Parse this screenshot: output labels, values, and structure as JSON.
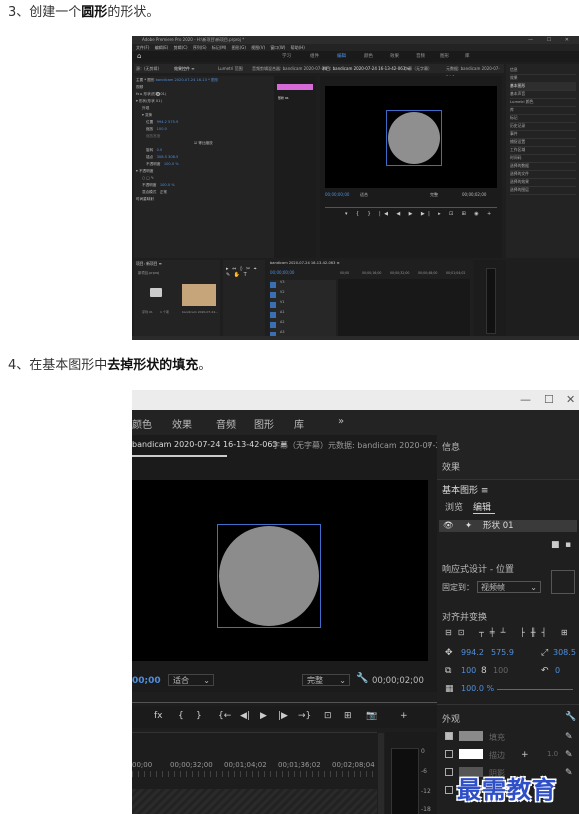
{
  "step3": {
    "num": "3、",
    "pre": "创建一个",
    "bold": "圆形",
    "post": "的形状。"
  },
  "step4": {
    "num": "4、",
    "pre": "在基本图形中",
    "bold": "去掉形状的填充",
    "post": "。"
  },
  "shot1": {
    "window_title": "Adobe Premiere Pro 2020 - H:\\新项目\\新项目.prproj *",
    "window_controls": "— ☐ ✕",
    "menu": [
      "文件(F)",
      "编辑(E)",
      "剪辑(C)",
      "序列(S)",
      "标记(M)",
      "图形(G)",
      "视图(V)",
      "窗口(W)",
      "帮助(H)"
    ],
    "workspaces": [
      "学习",
      "组件",
      "编辑",
      "颜色",
      "效果",
      "音频",
      "图形",
      "库"
    ],
    "panel_tabs": {
      "source": "源：(无剪辑)",
      "effect_controls": "效果控件 ≡",
      "lumetri": "Lumetri 范围",
      "audio_mixer": "音频剪辑混合器: bandicam 2020-07-24",
      "program": "节目: bandicam 2020-07-24 16-13-42-063 ≡",
      "captions": "字幕（无字幕）",
      "metadata": "元数据: bandicam 2020-07-24 1"
    },
    "ec_rows": [
      {
        "label": "主要 * 图形",
        "value": "bandicam 2020-07-24 16-13 * 图形"
      },
      {
        "label": "视频",
        "value": ""
      },
      {
        "label": "fx ▸ 形状(形状 01)",
        "value": ""
      },
      {
        "label": "▾ 形状(形状 01)",
        "value": ""
      },
      {
        "label": "外观",
        "value": ""
      },
      {
        "label": "▾ 变换",
        "value": ""
      },
      {
        "label": "位置",
        "value": "994.2   575.9"
      },
      {
        "label": "缩放",
        "value": "100.0"
      },
      {
        "label": "缩放宽度",
        "value": ""
      },
      {
        "label": "",
        "value": "☑ 等比缩放"
      },
      {
        "label": "旋转",
        "value": "0.0"
      },
      {
        "label": "锚点",
        "value": "308.5   308.5"
      },
      {
        "label": "不透明度",
        "value": "100.0 %"
      },
      {
        "label": "▾ 不透明度",
        "value": ""
      },
      {
        "label": "○ □ ✎",
        "value": ""
      },
      {
        "label": "不透明度",
        "value": "100.0 %"
      },
      {
        "label": "混合模式",
        "value": "正常"
      },
      {
        "label": "时间重映射",
        "value": ""
      }
    ],
    "ec_clip": "形状 01",
    "program_tc_left": "00;00;00;00",
    "program_fit": "适合",
    "program_full": "完整",
    "program_tc_right": "00;00;02;00",
    "right_panel": [
      "信息",
      "效果",
      "基本图形",
      "基本声音",
      "Lumetri 颜色",
      "库",
      "标记",
      "历史记录",
      "事件",
      "捕捉设置",
      "工作区域",
      "时间码",
      "选择的数据",
      "选择的文件",
      "选择的效果",
      "选择的图层"
    ],
    "right_panel_selected": "基本图形",
    "project": {
      "title": "项目: 新项目 ≡",
      "file": "新项目.prproj",
      "items": [
        "序列 01",
        "1 个项",
        "bandicam 2020-07-24..."
      ]
    },
    "timeline": {
      "title": "bandicam 2020-07-24 16-13-42-063 ≡",
      "timecode": "00;00;00;00",
      "ruler": [
        "00;00",
        "00;00;16;00",
        "00;00;32;00",
        "00;00;48;00",
        "00;01;04;02"
      ],
      "tracks": [
        "V3",
        "V2",
        "V1",
        "A1",
        "A2",
        "A3"
      ]
    }
  },
  "shot2": {
    "window_controls": [
      "—",
      "☐",
      "✕"
    ],
    "workspaces": [
      "颜色",
      "效果",
      "音频",
      "图形",
      "库",
      "»"
    ],
    "tabs": [
      "bandicam 2020-07-24 16-13-42-063 ≡",
      "字幕（无字幕）",
      "元数据: bandicam 2020-07-24 1",
      "»"
    ],
    "timecode_left": "00;00",
    "fit": "适合",
    "full": "完整",
    "timecode_right": "00;00;02;00",
    "controls": [
      "fx",
      "{",
      "}",
      "{←",
      "◀|",
      "▶",
      "|▶",
      "→}",
      "⊡",
      "⊞",
      "📷",
      "+"
    ],
    "ruler": [
      "00;00",
      "00;00;32;00",
      "00;01;04;02",
      "00;01;36;02",
      "00;02;08;04"
    ],
    "meter_labels": [
      "0",
      "-6",
      "-12",
      "-18"
    ],
    "right": {
      "info": "信息",
      "effects": "效果",
      "eg_title": "基本图形 ≡",
      "browse": "浏览",
      "edit": "编辑",
      "layer": "形状 01",
      "responsive": "响应式设计 - 位置",
      "pin_label": "固定到：",
      "pin_value": "视频帧",
      "align": "对齐并变换",
      "pos_x": "994.2",
      "pos_y": "575.9",
      "anchor": "308.5",
      "scale": "100",
      "scale2": "100",
      "rot": "0",
      "opacity": "100.0 %",
      "appearance": "外观",
      "fill": "填充",
      "stroke": "描边",
      "shadow": "阴影",
      "stroke_w": "1.0"
    }
  },
  "watermark": "最需教育"
}
